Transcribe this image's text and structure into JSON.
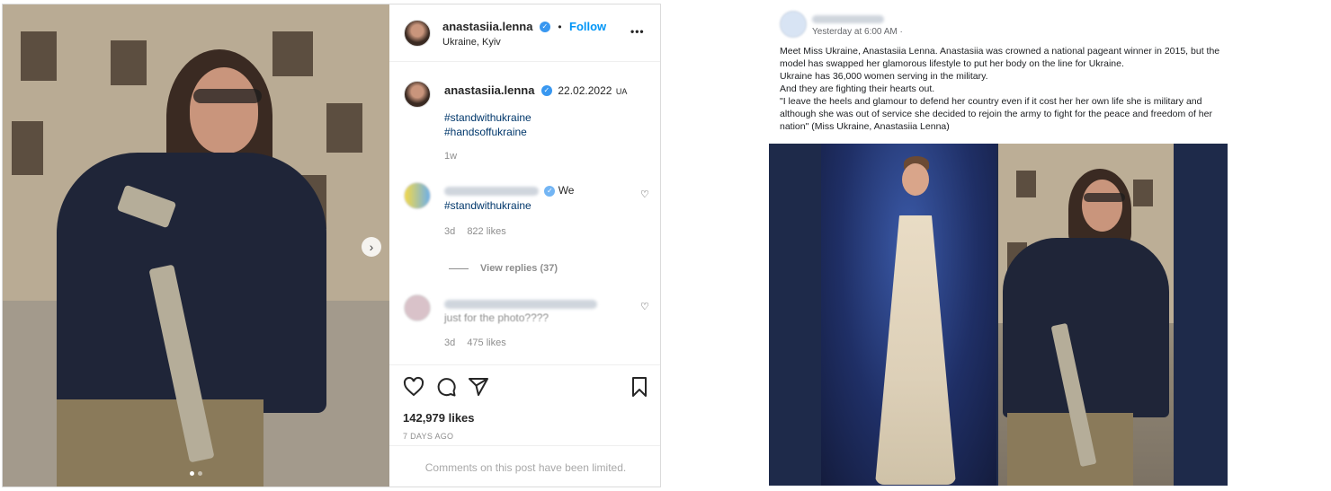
{
  "instagram": {
    "username": "anastasiia.lenna",
    "follow_label": "Follow",
    "location": "Ukraine, Kyiv",
    "more_label": "•••",
    "caption": {
      "username": "anastasiia.lenna",
      "date": "22.02.2022",
      "country_code": "UA",
      "tags": [
        "#standwithukraine",
        "#handsoffukraine"
      ],
      "age": "1w"
    },
    "comments": [
      {
        "text_suffix": "We",
        "text_line2": "#standwithukraine",
        "age": "3d",
        "likes": "822 likes"
      },
      {
        "text_line2": "just for the photo????",
        "age": "3d",
        "likes": "475 likes"
      }
    ],
    "view_replies": "View replies (37)",
    "likes_count": "142,979 likes",
    "posted_ago": "7 DAYS AGO",
    "comments_limited": "Comments on this post have been limited."
  },
  "facebook": {
    "timestamp": "Yesterday at 6:00 AM ·",
    "body": [
      "Meet Miss Ukraine, Anastasiia Lenna. Anastasiia was crowned a national pageant winner in 2015, but the model has swapped her glamorous lifestyle to put her body on the line for Ukraine.",
      "Ukraine has 36,000 women serving in the military.",
      "And they are fighting their hearts out.",
      "\"I leave the heels and glamour to defend her country even if it cost her her own life she is military and although she was out of service she decided to rejoin the army to fight for the peace and freedom of her nation\" (Miss Ukraine, Anastasiia Lenna)"
    ]
  },
  "icons": {
    "verified": "✓",
    "next": "›",
    "heart": "♡"
  },
  "colors": {
    "follow_blue": "#0095f6",
    "verified_blue": "#3897f0",
    "hashtag": "#00376b",
    "fb_media_bg": "#1e2a4a"
  }
}
